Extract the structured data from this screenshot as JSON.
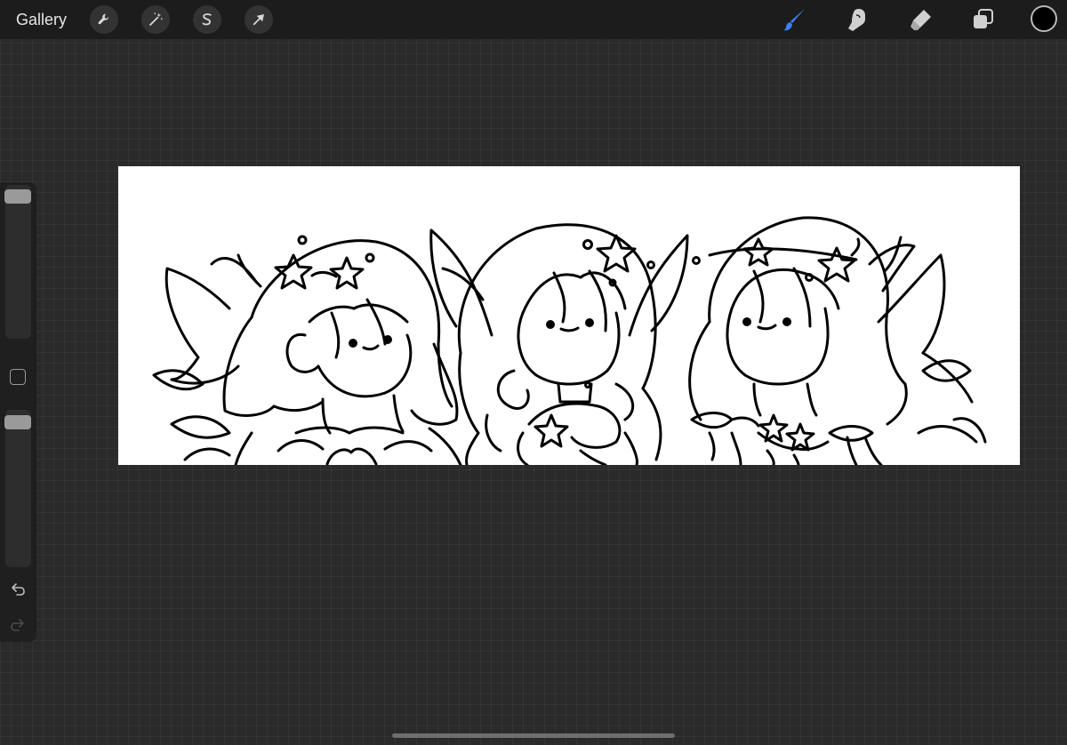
{
  "topbar": {
    "gallery_label": "Gallery",
    "left_tools": [
      {
        "name": "actions",
        "icon": "wrench-icon"
      },
      {
        "name": "adjustments",
        "icon": "magic-wand-icon"
      },
      {
        "name": "selection",
        "icon": "selection-s-icon"
      },
      {
        "name": "transform",
        "icon": "arrow-cursor-icon"
      }
    ],
    "right_tools": [
      {
        "name": "brush",
        "icon": "brush-icon",
        "active": true
      },
      {
        "name": "smudge",
        "icon": "smudge-finger-icon"
      },
      {
        "name": "eraser",
        "icon": "eraser-icon"
      },
      {
        "name": "layers",
        "icon": "layers-icon"
      }
    ],
    "current_color": "#000000",
    "accent_color": "#3b82f6"
  },
  "sidebar": {
    "brush_size_level": 0.03,
    "opacity_level": 0.04,
    "modify_icon": "square-icon",
    "undo_icon": "undo-arrow-icon",
    "redo_icon": "redo-arrow-icon"
  },
  "canvas": {
    "background": "#ffffff",
    "artwork": "line-art-three-fairies"
  }
}
